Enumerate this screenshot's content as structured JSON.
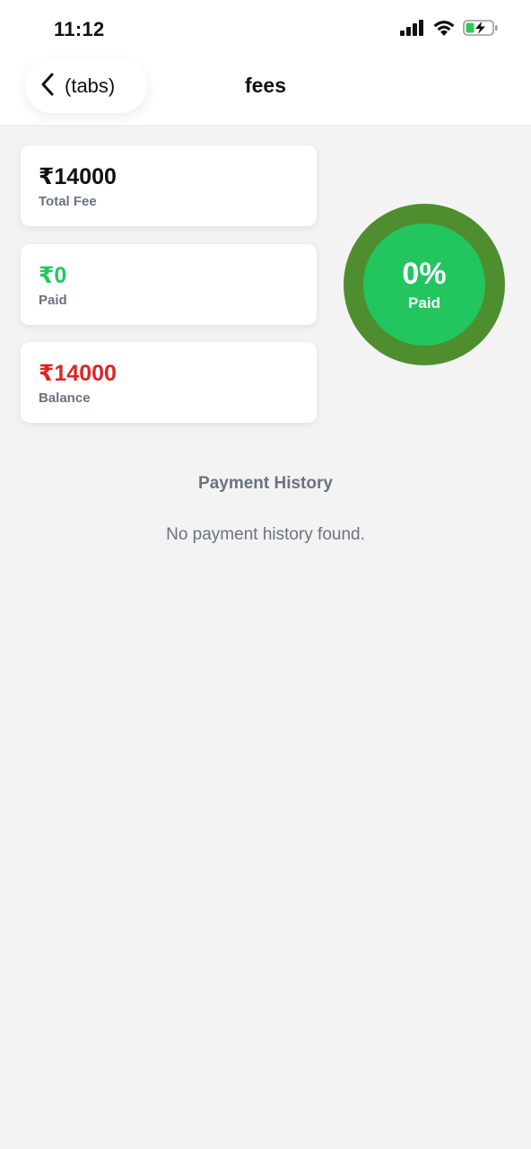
{
  "status_bar": {
    "time": "11:12",
    "icons": [
      "cellular-signal-icon",
      "wifi-icon",
      "battery-charging-icon"
    ],
    "battery_color": "#34c759"
  },
  "header": {
    "back_label": "(tabs)",
    "title": "fees"
  },
  "summary": {
    "total": {
      "amount": "₹14000",
      "label": "Total Fee",
      "color": "#111111"
    },
    "paid": {
      "amount": "₹0",
      "label": "Paid",
      "color": "#22c55e"
    },
    "balance": {
      "amount": "₹14000",
      "label": "Balance",
      "color": "#dc2626"
    }
  },
  "progress": {
    "percent_text": "0%",
    "label": "Paid",
    "value": 0,
    "outer_color": "#4e8e2f",
    "inner_color": "#22c55e"
  },
  "history": {
    "title": "Payment History",
    "empty_text": "No payment history found."
  }
}
